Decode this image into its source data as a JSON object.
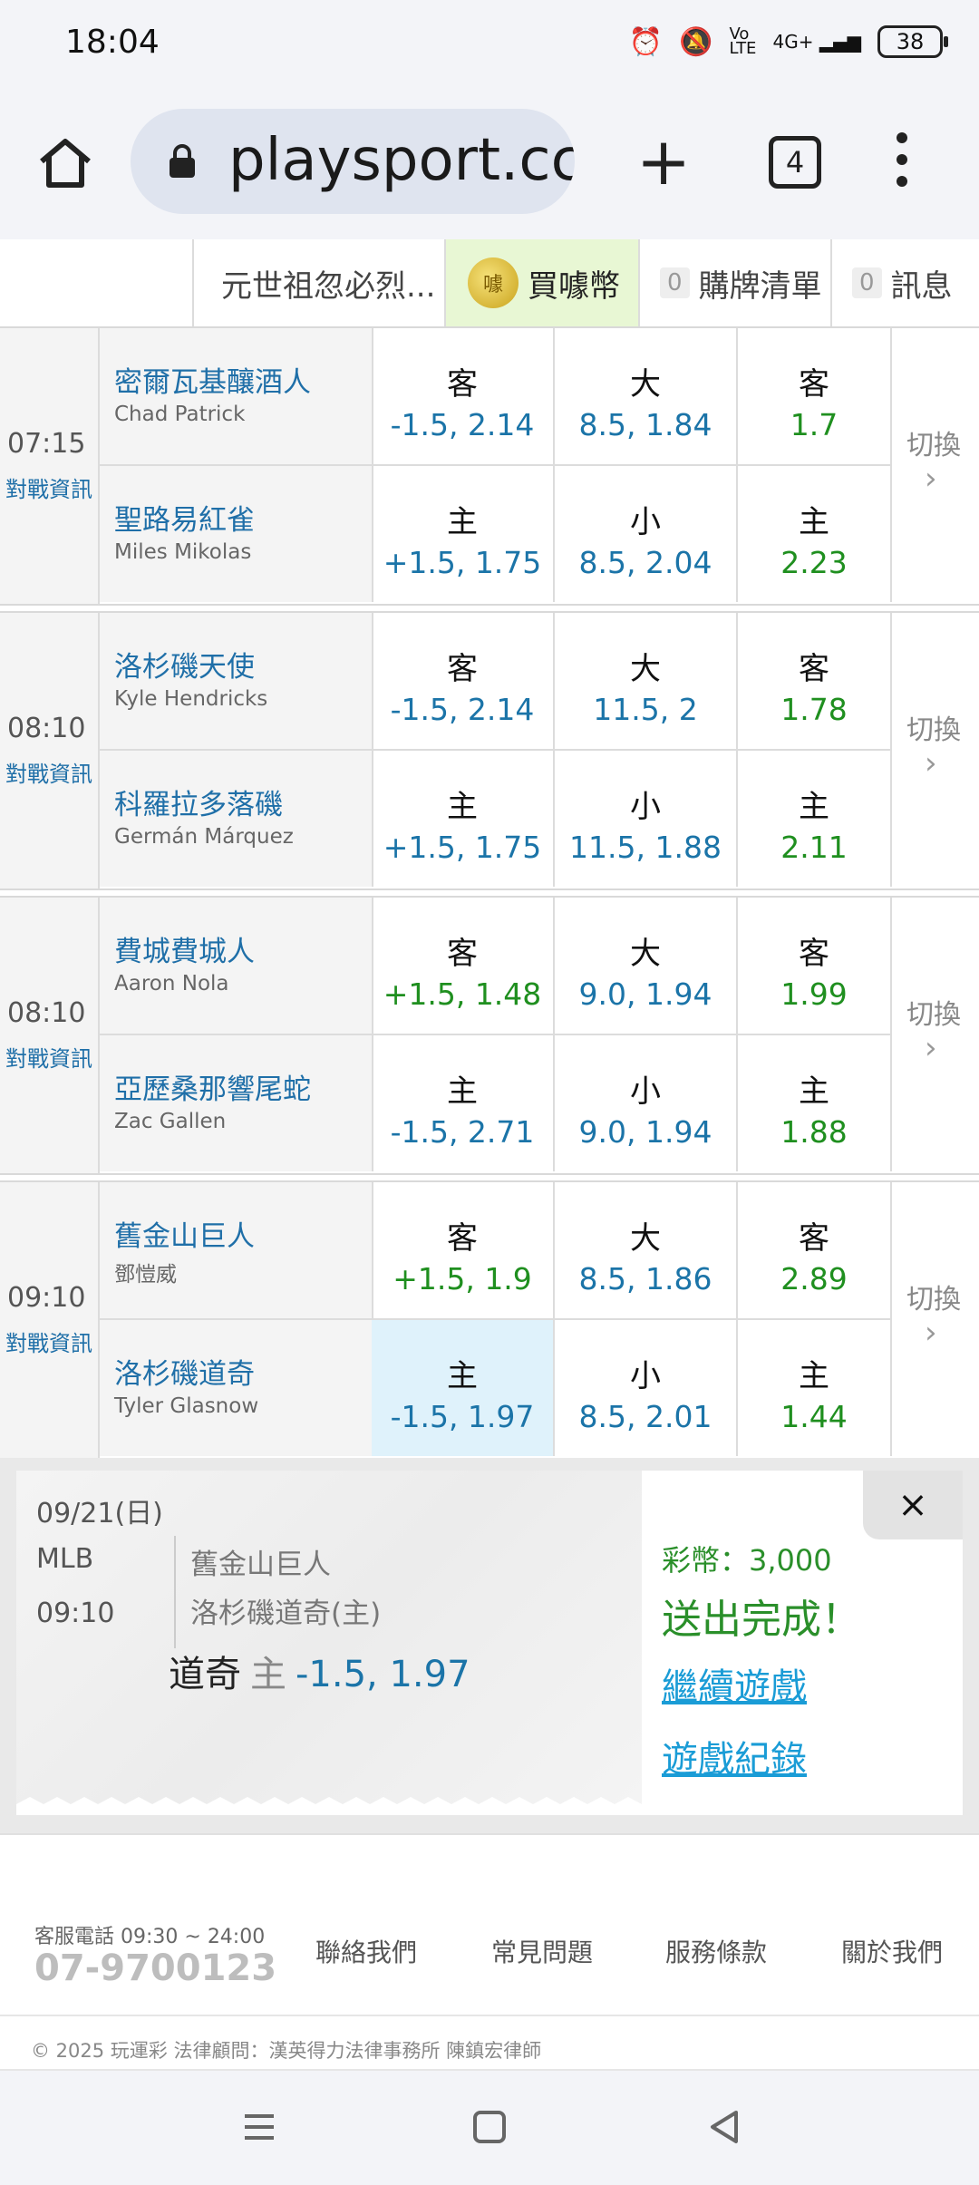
{
  "status": {
    "time": "18:04",
    "battery": "38",
    "network": "4G+",
    "volte": "Vo LTE"
  },
  "browser": {
    "url": "playsport.cc/",
    "tab_count": "4"
  },
  "site_nav": {
    "user": "元世祖忽必烈...",
    "buy": "買噱幣",
    "coin_icon_text": "噱",
    "cart_count": "0",
    "cart": "購牌清單",
    "msg_count": "0",
    "msg": "訊息"
  },
  "games": [
    {
      "time": "07:15",
      "info": "對戰資訊",
      "away": {
        "team": "密爾瓦基釀酒人",
        "pitcher": "Chad Patrick",
        "spread_label": "客",
        "spread": "-1.5, 2.14",
        "total_label": "大",
        "total": "8.5, 1.84",
        "ml_label": "客",
        "ml": "1.7"
      },
      "home": {
        "team": "聖路易紅雀",
        "pitcher": "Miles Mikolas",
        "spread_label": "主",
        "spread": "+1.5, 1.75",
        "total_label": "小",
        "total": "8.5, 2.04",
        "ml_label": "主",
        "ml": "2.23"
      },
      "switch": "切換"
    },
    {
      "time": "08:10",
      "info": "對戰資訊",
      "away": {
        "team": "洛杉磯天使",
        "pitcher": "Kyle Hendricks",
        "spread_label": "客",
        "spread": "-1.5, 2.14",
        "total_label": "大",
        "total": "11.5, 2",
        "ml_label": "客",
        "ml": "1.78"
      },
      "home": {
        "team": "科羅拉多落磯",
        "pitcher": "Germán Márquez",
        "spread_label": "主",
        "spread": "+1.5, 1.75",
        "total_label": "小",
        "total": "11.5, 1.88",
        "ml_label": "主",
        "ml": "2.11"
      },
      "switch": "切換"
    },
    {
      "time": "08:10",
      "info": "對戰資訊",
      "away": {
        "team": "費城費城人",
        "pitcher": "Aaron Nola",
        "spread_label": "客",
        "spread": "+1.5, 1.48",
        "total_label": "大",
        "total": "9.0, 1.94",
        "ml_label": "客",
        "ml": "1.99"
      },
      "home": {
        "team": "亞歷桑那響尾蛇",
        "pitcher": "Zac Gallen",
        "spread_label": "主",
        "spread": "-1.5, 2.71",
        "total_label": "小",
        "total": "9.0, 1.94",
        "ml_label": "主",
        "ml": "1.88"
      },
      "switch": "切換"
    },
    {
      "time": "09:10",
      "info": "對戰資訊",
      "away": {
        "team": "舊金山巨人",
        "pitcher": "鄧愷威",
        "spread_label": "客",
        "spread": "+1.5, 1.9",
        "total_label": "大",
        "total": "8.5, 1.86",
        "ml_label": "客",
        "ml": "2.89"
      },
      "home": {
        "team": "洛杉磯道奇",
        "pitcher": "Tyler Glasnow",
        "spread_label": "主",
        "spread": "-1.5, 1.97",
        "total_label": "小",
        "total": "8.5, 2.01",
        "ml_label": "主",
        "ml": "1.44"
      },
      "switch": "切換"
    }
  ],
  "confirm": {
    "date": "09/21(日)",
    "league": "MLB",
    "time": "09:10",
    "team1": "舊金山巨人",
    "team2": "洛杉磯道奇(主)",
    "pick_team": "道奇",
    "pick_side": "主",
    "pick_odds": "-1.5, 1.97",
    "coins": "彩幣：3,000",
    "done": "送出完成！",
    "continue": "繼續遊戲",
    "history": "遊戲紀錄",
    "close": "×"
  },
  "footer": {
    "hours": "客服電話 09:30 ~ 24:00",
    "phone": "07-9700123",
    "links": [
      "聯絡我們",
      "常見問題",
      "服務條款",
      "關於我們"
    ],
    "copyright": "© 2025 玩運彩 法律顧問：漢英得力法律事務所 陳鎮宏律師"
  },
  "colors": {
    "spread_text": "#1b74a8",
    "moneyline_text": "#1f8f1f",
    "selected_cell": "#dff2fb",
    "buy_bg": "#e8f7d4"
  }
}
